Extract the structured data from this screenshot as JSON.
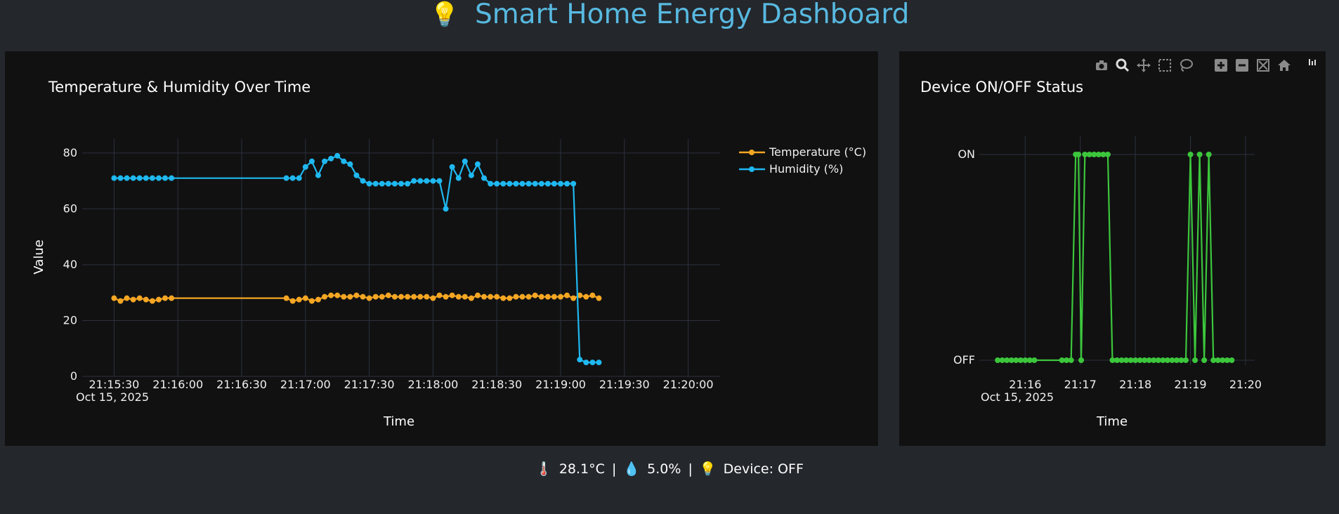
{
  "header": {
    "icon": "💡",
    "title": "Smart Home Energy Dashboard"
  },
  "status": {
    "temp_icon": "🌡️",
    "temperature": "28.1°C",
    "sep1": "|",
    "hum_icon": "💧",
    "humidity": "5.0%",
    "sep2": "|",
    "device_icon": "💡",
    "device": "Device: OFF"
  },
  "modebar": [
    "camera-icon",
    "zoom-icon",
    "pan-icon",
    "box-select-icon",
    "lasso-icon",
    "zoom-in-icon",
    "zoom-out-icon",
    "autoscale-icon",
    "reset-axes-icon",
    "plotly-logo-icon"
  ],
  "chart_data": [
    {
      "type": "line",
      "title": "Temperature & Humidity Over Time",
      "xlabel": "Time",
      "ylabel": "Value",
      "date_label": "Oct 15, 2025",
      "ylim": [
        0,
        85
      ],
      "yticks": [
        0,
        20,
        40,
        60,
        80
      ],
      "xticks": [
        "21:15:30",
        "21:16:00",
        "21:16:30",
        "21:17:00",
        "21:17:30",
        "21:18:00",
        "21:18:30",
        "21:19:00",
        "21:19:30",
        "21:20:00"
      ],
      "legend": "top-right",
      "grid": true,
      "x": [
        "21:15:30",
        "21:15:33",
        "21:15:36",
        "21:15:39",
        "21:15:42",
        "21:15:45",
        "21:15:48",
        "21:15:51",
        "21:15:54",
        "21:15:57",
        "21:16:51",
        "21:16:54",
        "21:16:57",
        "21:17:00",
        "21:17:03",
        "21:17:06",
        "21:17:09",
        "21:17:12",
        "21:17:15",
        "21:17:18",
        "21:17:21",
        "21:17:24",
        "21:17:27",
        "21:17:30",
        "21:17:33",
        "21:17:36",
        "21:17:39",
        "21:17:42",
        "21:17:45",
        "21:17:48",
        "21:17:51",
        "21:17:54",
        "21:17:57",
        "21:18:00",
        "21:18:03",
        "21:18:06",
        "21:18:09",
        "21:18:12",
        "21:18:15",
        "21:18:18",
        "21:18:21",
        "21:18:24",
        "21:18:27",
        "21:18:30",
        "21:18:33",
        "21:18:36",
        "21:18:39",
        "21:18:42",
        "21:18:45",
        "21:18:48",
        "21:18:51",
        "21:18:54",
        "21:18:57",
        "21:19:00",
        "21:19:03",
        "21:19:06",
        "21:19:09",
        "21:19:12",
        "21:19:15",
        "21:19:18"
      ],
      "series": [
        {
          "name": "Temperature (°C)",
          "color": "#f5a623",
          "values": [
            28,
            27,
            28,
            27.5,
            28,
            27.5,
            27,
            27.5,
            28,
            28,
            28,
            27,
            27.5,
            28,
            27,
            27.5,
            28.5,
            29,
            29,
            28.5,
            28.5,
            29,
            28.5,
            28,
            28.5,
            28.5,
            29,
            28.5,
            28.5,
            28.5,
            28.5,
            28.5,
            28.5,
            28,
            29,
            28.5,
            29,
            28.5,
            28.5,
            28,
            29,
            28.5,
            28.5,
            28.5,
            28,
            28,
            28.5,
            28.5,
            28.5,
            29,
            28.5,
            28.5,
            28.5,
            28.5,
            29,
            28,
            29,
            28.5,
            29,
            28
          ]
        },
        {
          "name": "Humidity (%)",
          "color": "#1fb8f0",
          "values": [
            71,
            71,
            71,
            71,
            71,
            71,
            71,
            71,
            71,
            71,
            71,
            71,
            71,
            75,
            77,
            72,
            77,
            78,
            79,
            77,
            76,
            72,
            70,
            69,
            69,
            69,
            69,
            69,
            69,
            69,
            70,
            70,
            70,
            70,
            70,
            60,
            75,
            71,
            77,
            72,
            76,
            71,
            69,
            69,
            69,
            69,
            69,
            69,
            69,
            69,
            69,
            69,
            69,
            69,
            69,
            69,
            6,
            5,
            5,
            5
          ]
        }
      ]
    },
    {
      "type": "line",
      "title": "Device ON/OFF Status",
      "xlabel": "Time",
      "date_label": "Oct 15, 2025",
      "yticks": [
        "OFF",
        "ON"
      ],
      "xticks": [
        "21:16",
        "21:17",
        "21:18",
        "21:19",
        "21:20"
      ],
      "grid": true,
      "x": [
        "21:15:30",
        "21:15:35",
        "21:15:40",
        "21:15:45",
        "21:15:50",
        "21:15:55",
        "21:16:00",
        "21:16:05",
        "21:16:10",
        "21:16:40",
        "21:16:45",
        "21:16:50",
        "21:16:55",
        "21:16:58",
        "21:17:01",
        "21:17:05",
        "21:17:10",
        "21:17:15",
        "21:17:20",
        "21:17:25",
        "21:17:30",
        "21:17:35",
        "21:17:40",
        "21:17:45",
        "21:17:50",
        "21:17:55",
        "21:18:00",
        "21:18:05",
        "21:18:10",
        "21:18:15",
        "21:18:20",
        "21:18:25",
        "21:18:30",
        "21:18:35",
        "21:18:40",
        "21:18:45",
        "21:18:50",
        "21:18:55",
        "21:19:00",
        "21:19:05",
        "21:19:10",
        "21:19:15",
        "21:19:20",
        "21:19:25",
        "21:19:30",
        "21:19:35",
        "21:19:40",
        "21:19:45"
      ],
      "series": [
        {
          "name": "Device",
          "color": "#3cc63c",
          "values": [
            0,
            0,
            0,
            0,
            0,
            0,
            0,
            0,
            0,
            0,
            0,
            0,
            1,
            1,
            0,
            1,
            1,
            1,
            1,
            1,
            1,
            0,
            0,
            0,
            0,
            0,
            0,
            0,
            0,
            0,
            0,
            0,
            0,
            0,
            0,
            0,
            0,
            0,
            1,
            0,
            1,
            0,
            1,
            0,
            0,
            0,
            0,
            0
          ]
        }
      ]
    }
  ]
}
